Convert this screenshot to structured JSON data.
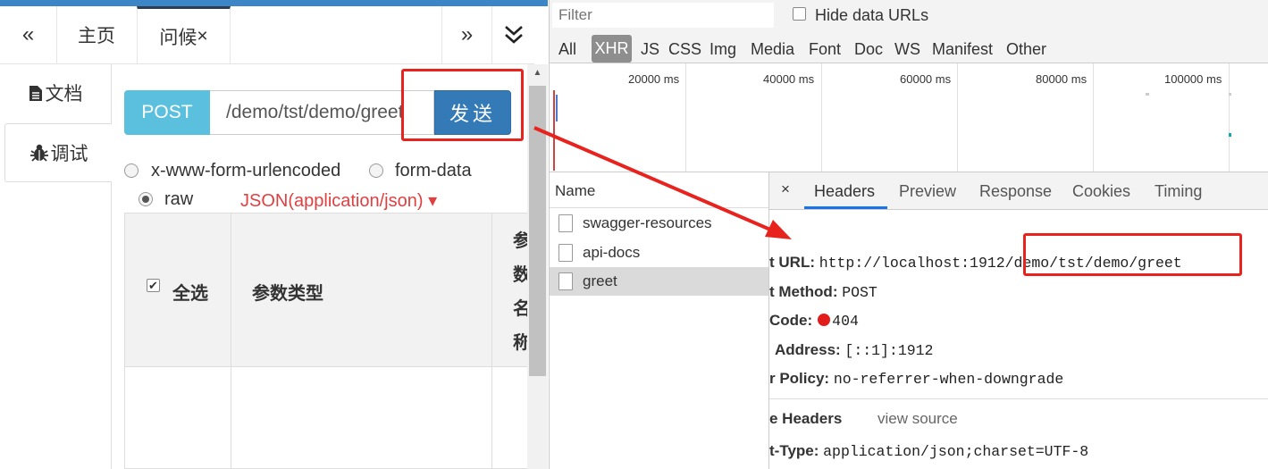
{
  "tabs": {
    "prev": "«",
    "home": "主页",
    "greet": "问候",
    "greet_close": "×",
    "next": "»"
  },
  "sidebar": {
    "doc_label": "文档",
    "debug_label": "调试"
  },
  "request": {
    "method": "POST",
    "url": "/demo/tst/demo/greet",
    "send_label": "发送",
    "body_types": [
      "x-www-form-urlencoded",
      "form-data",
      "raw"
    ],
    "selected_body_type": "raw",
    "content_type": "JSON(application/json)",
    "content_type_caret": "▾"
  },
  "param_table": {
    "select_all": "全选",
    "param_type": "参数类型",
    "param_name": "参数名称"
  },
  "devtools": {
    "filter_placeholder": "Filter",
    "hide_data_urls": "Hide data URLs",
    "types": [
      "All",
      "XHR",
      "JS",
      "CSS",
      "Img",
      "Media",
      "Font",
      "Doc",
      "WS",
      "Manifest",
      "Other"
    ],
    "active_type": "XHR",
    "ticks": [
      "20000 ms",
      "40000 ms",
      "60000 ms",
      "80000 ms",
      "100000 ms"
    ],
    "name_header": "Name",
    "requests": [
      "swagger-resources",
      "api-docs",
      "greet"
    ],
    "selected_request": "greet",
    "detail_tabs": {
      "close": "×",
      "headers": "Headers",
      "preview": "Preview",
      "response": "Response",
      "cookies": "Cookies",
      "timing": "Timing"
    },
    "general": {
      "url_key": "t URL:",
      "url_val": "http://localhost:1912/demo/tst/demo/greet",
      "method_key": "t Method:",
      "method_val": "POST",
      "code_key": "Code:",
      "code_val": "404",
      "addr_key": "Address:",
      "addr_val": "[::1]:1912",
      "policy_key": "r Policy:",
      "policy_val": "no-referrer-when-downgrade"
    },
    "section_title": "e Headers",
    "view_source": "view source",
    "ctype_key": "t-Type:",
    "ctype_val": "application/json;charset=UTF-8"
  },
  "colors": {
    "annotation": "#e8231e",
    "status_error": "#e21b1b",
    "method_badge": "#5bc0de",
    "send_button": "#337ab7"
  }
}
